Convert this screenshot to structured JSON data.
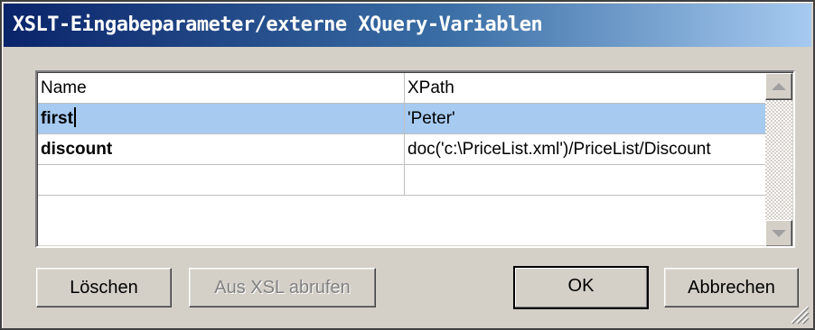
{
  "dialog": {
    "title": "XSLT-Eingabeparameter/externe XQuery-Variablen"
  },
  "table": {
    "headers": {
      "name": "Name",
      "xpath": "XPath"
    },
    "rows": [
      {
        "name": "first",
        "xpath": "'Peter'",
        "selected": true
      },
      {
        "name": "discount",
        "xpath": "doc('c:\\PriceList.xml')/PriceList/Discount",
        "selected": false
      },
      {
        "name": "",
        "xpath": "",
        "selected": false
      }
    ]
  },
  "buttons": {
    "delete": "Löschen",
    "fetch_from_xsl": "Aus XSL abrufen",
    "ok": "OK",
    "cancel": "Abbrechen"
  },
  "colors": {
    "title_gradient_start": "#0a246a",
    "title_gradient_end": "#a6caf0",
    "selection": "#a6caf0",
    "face": "#d4d0c8"
  },
  "icons": [
    "scroll-up-arrow-icon",
    "scroll-down-arrow-icon",
    "resize-grip-icon"
  ]
}
